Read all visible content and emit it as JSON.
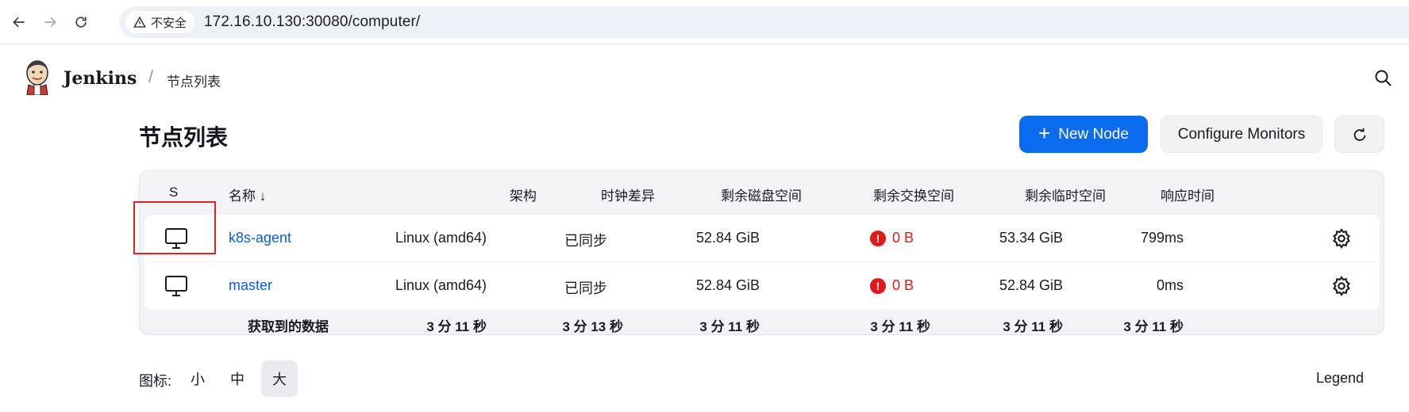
{
  "browser": {
    "security_label": "不安全",
    "url": "172.16.10.130:30080/computer/"
  },
  "header": {
    "brand": "Jenkins",
    "separator": "/",
    "breadcrumb": "节点列表"
  },
  "page": {
    "title": "节点列表",
    "new_node_label": "New Node",
    "configure_monitors_label": "Configure Monitors"
  },
  "table": {
    "headers": {
      "status": "S",
      "name": "名称 ↓",
      "arch": "架构",
      "clock": "时钟差异",
      "disk": "剩余磁盘空间",
      "swap": "剩余交换空间",
      "temp": "剩余临时空间",
      "response": "响应时间"
    },
    "rows": [
      {
        "name": "k8s-agent",
        "arch": "Linux (amd64)",
        "clock": "已同步",
        "disk": "52.84 GiB",
        "swap": "0 B",
        "temp": "53.34 GiB",
        "response": "799ms"
      },
      {
        "name": "master",
        "arch": "Linux (amd64)",
        "clock": "已同步",
        "disk": "52.84 GiB",
        "swap": "0 B",
        "temp": "52.84 GiB",
        "response": "0ms"
      }
    ],
    "footer": {
      "label": "获取到的数据",
      "arch": "3 分 11 秒",
      "clock": "3 分 13 秒",
      "disk": "3 分 11 秒",
      "swap": "3 分 11 秒",
      "temp": "3 分 11 秒",
      "response": "3 分 11 秒"
    }
  },
  "icon_size": {
    "label": "图标:",
    "small": "小",
    "medium": "中",
    "large": "大",
    "selected": "大"
  },
  "legend_label": "Legend",
  "colors": {
    "primary": "#0b6bef",
    "error": "#e11919",
    "link": "#0b5ed7",
    "highlight": "#e0231f"
  }
}
